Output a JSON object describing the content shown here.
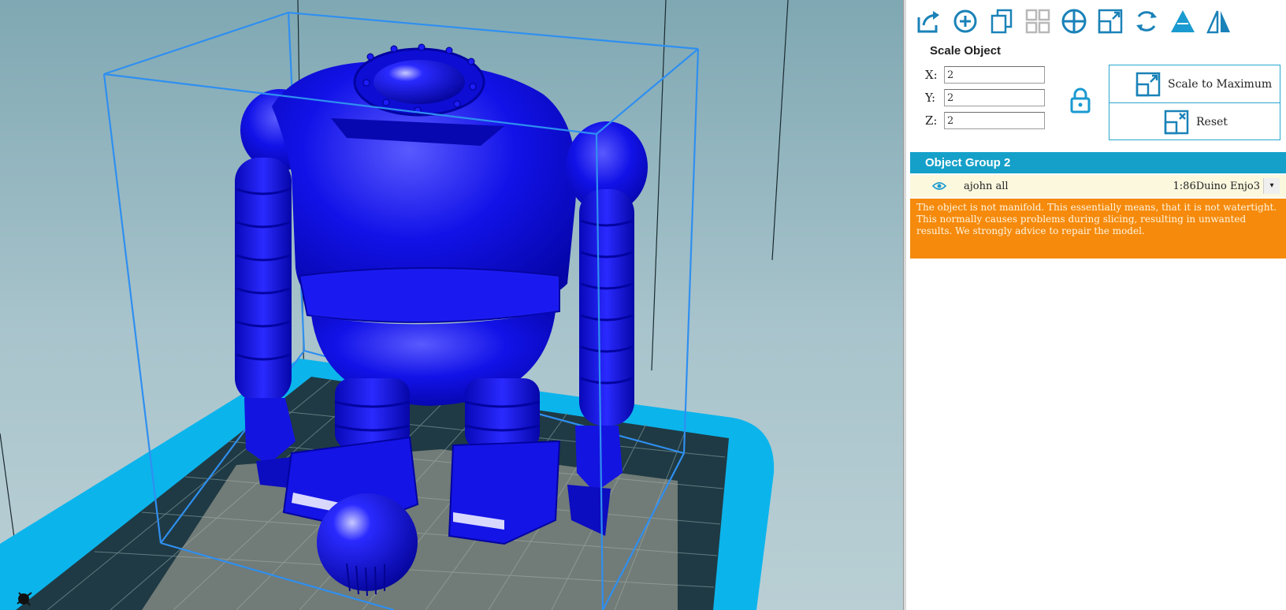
{
  "toolbar": {
    "icons": [
      "export-icon",
      "add-object-icon",
      "copy-icon",
      "arrange-icon",
      "center-icon",
      "scale-icon",
      "rotate-icon",
      "cut-icon",
      "mirror-icon"
    ]
  },
  "scale": {
    "title": "Scale Object",
    "x_label": "X:",
    "y_label": "Y:",
    "z_label": "Z:",
    "x_value": "2",
    "y_value": "2",
    "z_value": "2",
    "scale_to_max_label": "Scale to Maximum",
    "reset_label": "Reset"
  },
  "object_list": {
    "group_title": "Object Group 2",
    "object_name": "ajohn all",
    "printer": "1:86Duino Enjo3"
  },
  "warning": {
    "text": "The object is not manifold. This essentially means, that it is not watertight. This normally causes problems during slicing, resulting in unwanted results. We strongly advice to repair the model."
  },
  "colors": {
    "accent": "#15a0c9",
    "warning_bg": "#f58a0c",
    "model": "#1111e6",
    "bed": "#0cb4ec",
    "bounding_box": "#2f8ff0"
  }
}
